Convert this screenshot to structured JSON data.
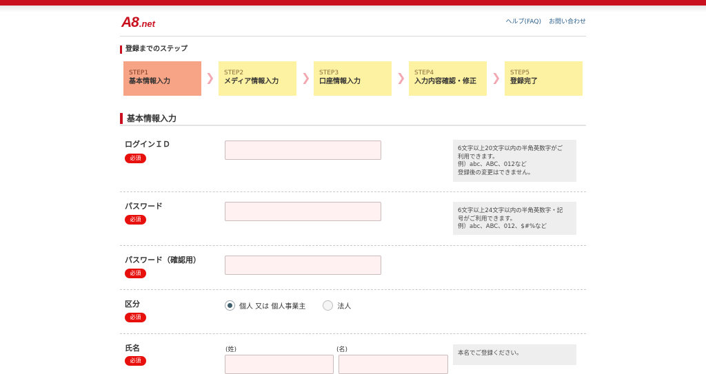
{
  "header": {
    "logo_main": "A8",
    "logo_sub": ".net",
    "links": [
      "ヘルプ(FAQ)",
      "お問い合わせ"
    ]
  },
  "steps": {
    "title": "登録までのステップ",
    "items": [
      {
        "num": "STEP1",
        "label": "基本情報入力",
        "active": true
      },
      {
        "num": "STEP2",
        "label": "メディア情報入力",
        "active": false
      },
      {
        "num": "STEP3",
        "label": "口座情報入力",
        "active": false
      },
      {
        "num": "STEP4",
        "label": "入力内容確認・修正",
        "active": false
      },
      {
        "num": "STEP5",
        "label": "登録完了",
        "active": false
      }
    ]
  },
  "section": {
    "title": "基本情報入力"
  },
  "form": {
    "required_badge": "必須",
    "login_id": {
      "label": "ログインＩＤ",
      "value": "",
      "hint": [
        "6文字以上20文字以内の半角英数字がご",
        "利用できます。",
        "例）abc、ABC、012など",
        "登録後の変更はできません。"
      ]
    },
    "password": {
      "label": "パスワード",
      "value": "",
      "hint": [
        "6文字以上24文字以内の半角英数字・記",
        "号がご利用できます。",
        "例）abc、ABC、012、$#%など"
      ]
    },
    "password_confirm": {
      "label": "パスワード（確認用）",
      "value": ""
    },
    "category": {
      "label": "区分",
      "options": [
        {
          "label": "個人 又は 個人事業主",
          "checked": true
        },
        {
          "label": "法人",
          "checked": false
        }
      ]
    },
    "name": {
      "label": "氏名",
      "last_label": "(姓)",
      "first_label": "(名)",
      "hint": "本名でご登録ください。"
    }
  },
  "colors": {
    "brand_red": "#c8101e",
    "step_active": "#f7a386",
    "step_inactive": "#fdf1a2",
    "input_bg": "#fff1f1"
  }
}
